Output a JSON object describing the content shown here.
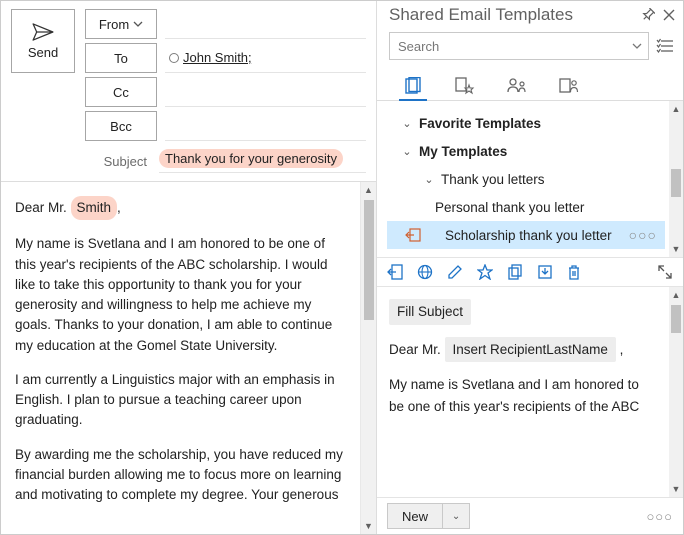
{
  "compose": {
    "send_label": "Send",
    "from_label": "From",
    "to_label": "To",
    "cc_label": "Cc",
    "bcc_label": "Bcc",
    "subject_label": "Subject",
    "to_value": "John Smith;",
    "subject_value": "Thank you for your generosity"
  },
  "body": {
    "greeting_prefix": "Dear Mr. ",
    "greeting_name": "Smith",
    "greeting_suffix": ",",
    "p1": "My name is Svetlana and I am honored to be one of this year's recipients of the ABC scholarship. I would like to take this opportunity to thank you for your generosity and willingness to help me achieve my goals. Thanks to your donation, I am able to continue my education at the Gomel State University.",
    "p2": "I am currently a Linguistics major with an emphasis in English. I plan to pursue a teaching career upon graduating.",
    "p3": "By awarding me the scholarship, you have reduced my financial burden allowing me to focus more on learning and motivating to complete my degree. Your generous"
  },
  "panel": {
    "title": "Shared Email Templates",
    "search_placeholder": "Search"
  },
  "tree": {
    "section1": "Favorite Templates",
    "section2": "My Templates",
    "folder": "Thank you letters",
    "item1": "Personal thank you letter",
    "item2": "Scholarship thank you letter"
  },
  "preview": {
    "fill_subject": "Fill Subject",
    "greeting_prefix": "Dear Mr. ",
    "macro": "Insert RecipientLastName",
    "greeting_suffix": ",",
    "body": "My name is Svetlana and I am honored to be one of this year's recipients of the ABC"
  },
  "bottom": {
    "new_label": "New"
  }
}
